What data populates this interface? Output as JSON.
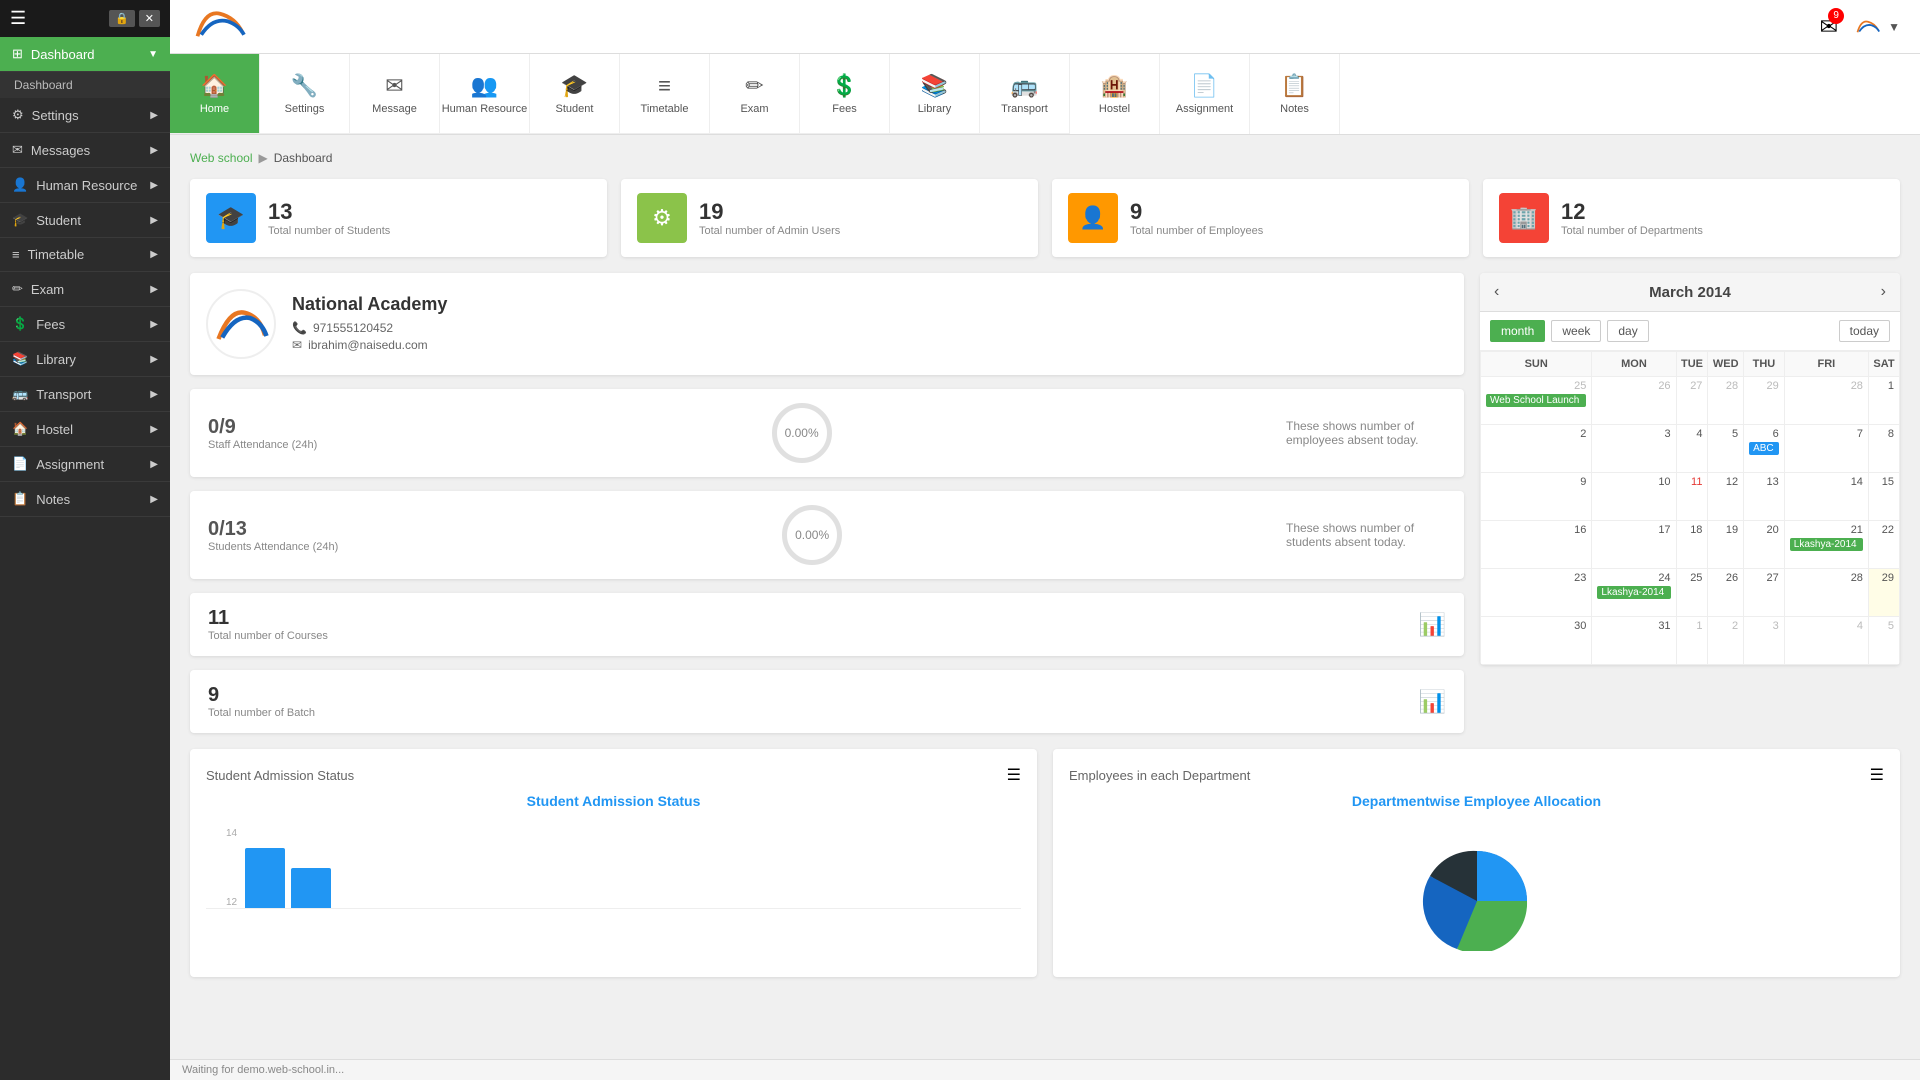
{
  "sidebar": {
    "items": [
      {
        "id": "dashboard",
        "label": "Dashboard",
        "icon": "⊞",
        "active": true,
        "sub": [
          "Dashboard"
        ]
      },
      {
        "id": "settings",
        "label": "Settings",
        "icon": "⚙"
      },
      {
        "id": "messages",
        "label": "Messages",
        "icon": "✉"
      },
      {
        "id": "human-resource",
        "label": "Human Resource",
        "icon": "👤"
      },
      {
        "id": "student",
        "label": "Student",
        "icon": "🎓"
      },
      {
        "id": "timetable",
        "label": "Timetable",
        "icon": "≡"
      },
      {
        "id": "exam",
        "label": "Exam",
        "icon": "✏"
      },
      {
        "id": "fees",
        "label": "Fees",
        "icon": "💲"
      },
      {
        "id": "library",
        "label": "Library",
        "icon": "📚"
      },
      {
        "id": "transport",
        "label": "Transport",
        "icon": "🚌"
      },
      {
        "id": "hostel",
        "label": "Hostel",
        "icon": "🏠"
      },
      {
        "id": "assignment",
        "label": "Assignment",
        "icon": "📄"
      },
      {
        "id": "notes",
        "label": "Notes",
        "icon": "📋"
      }
    ]
  },
  "topnav": {
    "icons": [
      {
        "id": "home",
        "label": "Home",
        "icon": "🏠",
        "active": true
      },
      {
        "id": "settings",
        "label": "Settings",
        "icon": "🔧"
      },
      {
        "id": "message",
        "label": "Message",
        "icon": "✉"
      },
      {
        "id": "human-resource",
        "label": "Human Resource",
        "icon": "👥"
      },
      {
        "id": "student",
        "label": "Student",
        "icon": "🎓"
      },
      {
        "id": "timetable",
        "label": "Timetable",
        "icon": "≡"
      },
      {
        "id": "exam",
        "label": "Exam",
        "icon": "✏"
      },
      {
        "id": "fees",
        "label": "Fees",
        "icon": "💲"
      },
      {
        "id": "library",
        "label": "Library",
        "icon": "📚"
      },
      {
        "id": "transport",
        "label": "Transport",
        "icon": "🚌"
      },
      {
        "id": "hostel",
        "label": "Hostel",
        "icon": "🏨"
      },
      {
        "id": "assignment",
        "label": "Assignment",
        "icon": "📄"
      },
      {
        "id": "notes",
        "label": "Notes",
        "icon": "📋"
      }
    ]
  },
  "breadcrumb": {
    "parent": "Web school",
    "current": "Dashboard"
  },
  "stats": [
    {
      "num": "13",
      "label": "Total number of Students",
      "color": "#2196f3",
      "icon": "🎓"
    },
    {
      "num": "19",
      "label": "Total number of Admin Users",
      "color": "#8bc34a",
      "icon": "⚙"
    },
    {
      "num": "9",
      "label": "Total number of Employees",
      "color": "#ff9800",
      "icon": "👤"
    },
    {
      "num": "12",
      "label": "Total number of Departments",
      "color": "#f44336",
      "icon": "🏢"
    }
  ],
  "school": {
    "name": "National Academy",
    "phone": "971555120452",
    "email": "ibrahim@naisedu.com"
  },
  "attendance": [
    {
      "value": "0/9",
      "label": "Staff Attendance (24h)",
      "percent": "0.00%",
      "desc": "These shows number of employees absent today."
    },
    {
      "value": "0/13",
      "label": "Students Attendance (24h)",
      "percent": "0.00%",
      "desc": "These shows number of students absent today."
    }
  ],
  "metrics": [
    {
      "num": "11",
      "label": "Total number of Courses"
    },
    {
      "num": "9",
      "label": "Total number of Batch"
    }
  ],
  "calendar": {
    "title": "March 2014",
    "view_buttons": [
      "month",
      "week",
      "day"
    ],
    "active_view": "month",
    "today_btn": "today",
    "days": [
      "SUN",
      "MON",
      "TUE",
      "WED",
      "THU",
      "FRI",
      "SAT"
    ],
    "weeks": [
      [
        {
          "day": "25",
          "other": true
        },
        {
          "day": "26",
          "other": true
        },
        {
          "day": "27",
          "other": true
        },
        {
          "day": "28",
          "other": true
        },
        {
          "day": "29",
          "other": true
        },
        {
          "day": "28",
          "other": true
        },
        {
          "day": "1",
          "event": ""
        }
      ],
      [
        {
          "day": "2"
        },
        {
          "day": "3"
        },
        {
          "day": "4"
        },
        {
          "day": "5"
        },
        {
          "day": "6",
          "event": "ABC",
          "event_color": "blue"
        },
        {
          "day": "7"
        },
        {
          "day": "8"
        }
      ],
      [
        {
          "day": "9"
        },
        {
          "day": "10"
        },
        {
          "day": "11",
          "red": true
        },
        {
          "day": "12"
        },
        {
          "day": "13"
        },
        {
          "day": "14"
        },
        {
          "day": "15"
        }
      ],
      [
        {
          "day": "16"
        },
        {
          "day": "17"
        },
        {
          "day": "18"
        },
        {
          "day": "19"
        },
        {
          "day": "20"
        },
        {
          "day": "21",
          "event": "Lkashya-2014",
          "event_color": "green"
        },
        {
          "day": "22"
        }
      ],
      [
        {
          "day": "23"
        },
        {
          "day": "24",
          "event": "Lkashya-2014",
          "event_color": "green"
        },
        {
          "day": "25"
        },
        {
          "day": "26"
        },
        {
          "day": "27"
        },
        {
          "day": "28"
        },
        {
          "day": "29",
          "today": true
        }
      ],
      [
        {
          "day": "30"
        },
        {
          "day": "31"
        },
        {
          "day": "1",
          "other": true
        },
        {
          "day": "2",
          "other": true
        },
        {
          "day": "3",
          "other": true
        },
        {
          "day": "4",
          "other": true
        },
        {
          "day": "5",
          "other": true
        }
      ]
    ],
    "events": [
      {
        "label": "Web School Launch",
        "day": "25",
        "color": "green"
      }
    ]
  },
  "charts": {
    "admission": {
      "title": "Student Admission Status",
      "section_title": "Student Admission Status",
      "y_labels": [
        "14",
        "12"
      ],
      "bars": [
        {
          "label": "",
          "height": 60,
          "color": "#2196f3"
        },
        {
          "label": "",
          "height": 40,
          "color": "#2196f3"
        }
      ]
    },
    "department": {
      "title": "Departmentwise Employee Allocation",
      "section_title": "Employees in each Department"
    }
  },
  "statusbar": {
    "text": "Waiting for demo.web-school.in..."
  },
  "header_buttons": [
    "",
    ""
  ],
  "mail_badge": "9"
}
